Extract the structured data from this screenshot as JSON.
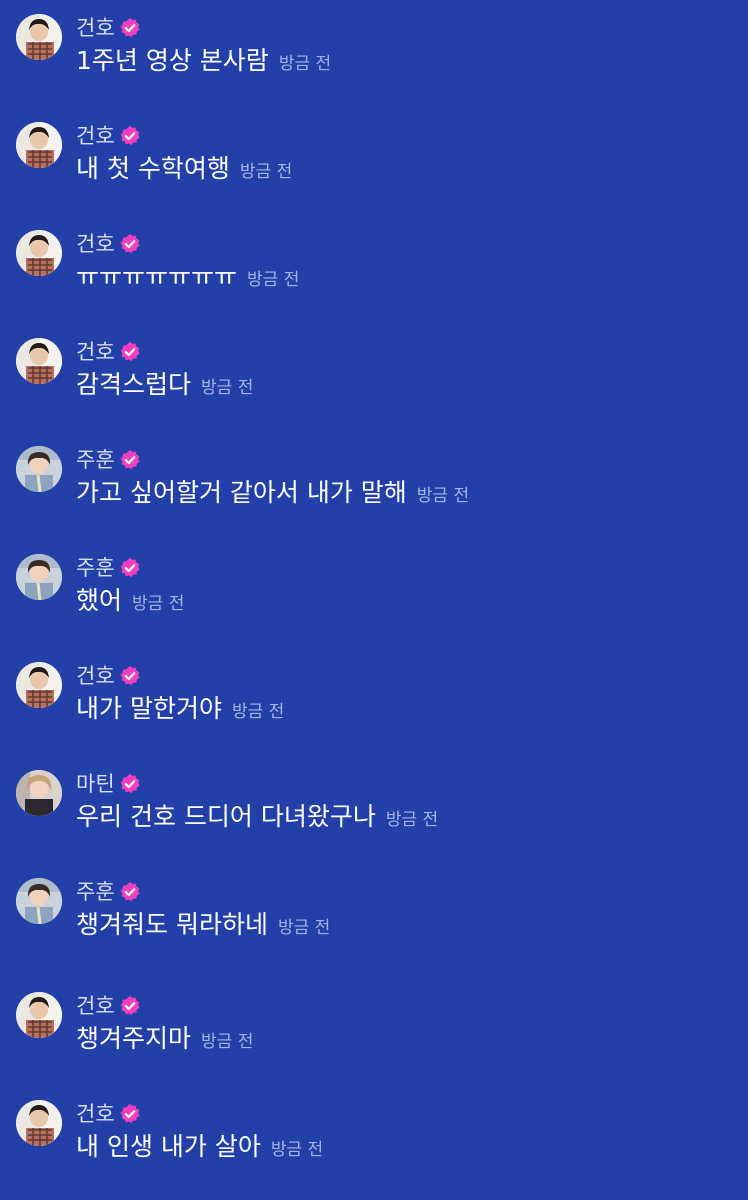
{
  "badge_color": "#f23fc0",
  "time_label": "방금 전",
  "messages": [
    {
      "name": "건호",
      "text": "1주년 영상 본사람",
      "time": "방금 전",
      "avatar": "avatar-geonho"
    },
    {
      "name": "건호",
      "text": "내 첫 수학여행",
      "time": "방금 전",
      "avatar": "avatar-geonho"
    },
    {
      "name": "건호",
      "text": "ㅠㅠㅠㅠㅠㅠㅠ",
      "time": "방금 전",
      "avatar": "avatar-geonho"
    },
    {
      "name": "건호",
      "text": "감격스럽다",
      "time": "방금 전",
      "avatar": "avatar-geonho"
    },
    {
      "name": "주훈",
      "text": "가고 싶어할거 같아서 내가 말해",
      "time": "방금 전",
      "avatar": "avatar-juhun"
    },
    {
      "name": "주훈",
      "text": "했어",
      "time": "방금 전",
      "avatar": "avatar-juhun"
    },
    {
      "name": "건호",
      "text": "내가 말한거야",
      "time": "방금 전",
      "avatar": "avatar-geonho"
    },
    {
      "name": "마틴",
      "text": "우리 건호 드디어 다녀왔구나",
      "time": "방금 전",
      "avatar": "avatar-martin"
    },
    {
      "name": "주훈",
      "text": "챙겨줘도 뭐라하네",
      "time": "방금 전",
      "avatar": "avatar-juhun"
    },
    {
      "name": "건호",
      "text": "챙겨주지마",
      "time": "방금 전",
      "avatar": "avatar-geonho"
    },
    {
      "name": "건호",
      "text": "내 인생 내가 살아",
      "time": "방금 전",
      "avatar": "avatar-geonho"
    }
  ]
}
